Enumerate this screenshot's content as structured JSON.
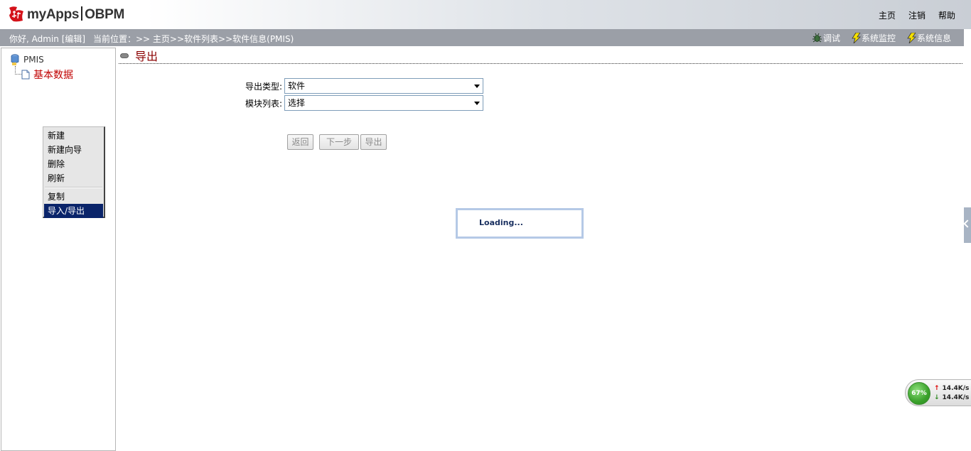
{
  "header": {
    "logo_text": "myApps",
    "logo_brand": "OBPM",
    "links": [
      "主页",
      "注销",
      "帮助"
    ]
  },
  "statusbar": {
    "greeting": "你好, Admin [编辑]",
    "location": "当前位置：>> 主页>>软件列表>>软件信息(PMIS)",
    "tools": [
      "调试",
      "系统监控",
      "系统信息"
    ]
  },
  "tree": {
    "root": "PMIS",
    "child": "基本数据"
  },
  "context_menu": {
    "items_group1": [
      "新建",
      "新建向导",
      "删除",
      "刷新"
    ],
    "items_group2": [
      "复制",
      "导入/导出"
    ],
    "active_item": "导入/导出"
  },
  "main": {
    "title": "导出",
    "export_type_label": "导出类型:",
    "export_type_value": "软件",
    "module_list_label": "模块列表:",
    "module_list_value": "选择",
    "buttons": {
      "back": "返回",
      "next": "下一步",
      "export": "导出"
    },
    "loading_text": "Loading..."
  },
  "net_widget": {
    "percent": "67%",
    "up_rate": "14.4K/s",
    "down_rate": "14.4K/s"
  },
  "colors": {
    "statusbar_bg": "#9b9fa7",
    "title_red": "#8b0000",
    "tree_child_red": "#c00000",
    "menu_active_bg": "#0a246a"
  }
}
